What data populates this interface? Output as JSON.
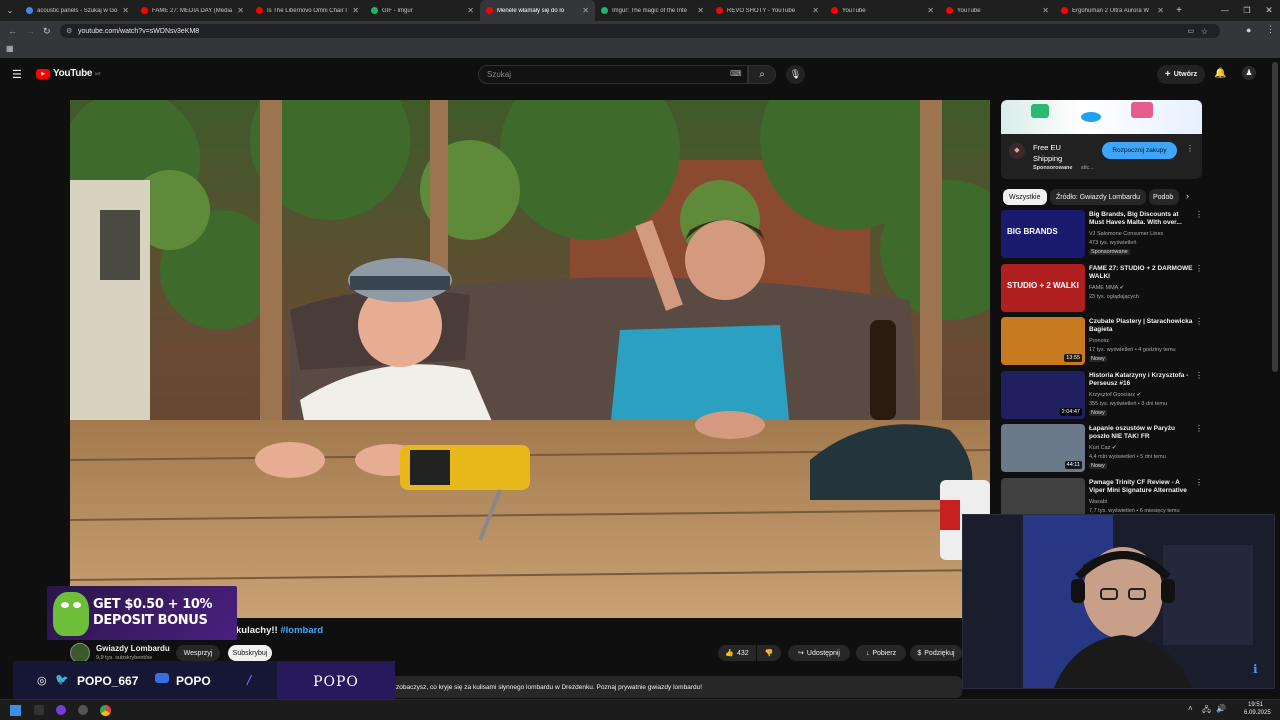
{
  "browser": {
    "tabs": [
      {
        "label": "acoustic panels - Szukaj w Go",
        "color": "#4285f4",
        "active": false
      },
      {
        "label": "FAME 27: MEDIA DAY (Media",
        "color": "#ff0000",
        "active": false
      },
      {
        "label": "Is The Libernovo Omni Chair I",
        "color": "#ff0000",
        "active": false
      },
      {
        "label": "GIF - Imgur",
        "color": "#1bb76e",
        "active": false
      },
      {
        "label": "Menele włamały się do lo",
        "color": "#ff0000",
        "active": true
      },
      {
        "label": "Imgur: The magic of the Inte",
        "color": "#1bb76e",
        "active": false
      },
      {
        "label": "REVO SHOTY - YouTube",
        "color": "#ff0000",
        "active": false
      },
      {
        "label": "YouTube",
        "color": "#ff0000",
        "active": false
      },
      {
        "label": "YouTube",
        "color": "#ff0000",
        "active": false
      },
      {
        "label": "Ergohuman 2 Ultra Aurora W",
        "color": "#ff0000",
        "active": false
      }
    ],
    "url": "youtube.com/watch?v=sWDNsv3eKM8"
  },
  "yt": {
    "logo_text": "YouTube",
    "logo_sup": "MT",
    "search_placeholder": "Szukaj",
    "create_label": "Utwórz"
  },
  "ad": {
    "title_line1": "Free EU",
    "title_line2": "Shipping",
    "sponsored": "Sponsorowane",
    "sponsored_tail": "stic...",
    "cta": "Rozpocznij zakupy"
  },
  "chips": [
    "Wszystkie",
    "Źródło: Gwiazdy Lombardu",
    "Podob"
  ],
  "videos": [
    {
      "title": "Big Brands, Big Discounts at Must Haves Malta. With over...",
      "channel": "VJ Salomone Consumer Lines",
      "meta": "473 tys. wyświetleń",
      "badge": "Sponsorowane",
      "duration": "",
      "thumb": "#1a1a6e",
      "thumb_text": "BIG BRANDS"
    },
    {
      "title": "FAME 27: STUDIO + 2 DARMOWE WALKI",
      "channel": "FAME MMA ✔",
      "meta": "23 tys. oglądających",
      "badge": "",
      "duration": "",
      "thumb": "#b02020",
      "thumb_text": "STUDIO + 2 WALKI"
    },
    {
      "title": "Czubate Plastery | Starachowicka Bagieta",
      "channel": "Pronosz",
      "meta": "17 tys. wyświetleń • 4 godziny temu",
      "badge": "Nowy",
      "duration": "13:55",
      "thumb": "#c87a20",
      "thumb_text": ""
    },
    {
      "title": "Historia Katarzyny i Krzysztofa - Perseusz #16",
      "channel": "Krzysztof Gonciarz ✔",
      "meta": "355 tys. wyświetleń • 3 dni temu",
      "badge": "Nowy",
      "duration": "2:04:47",
      "thumb": "#202060",
      "thumb_text": ""
    },
    {
      "title": "Łapanie oszustów w Paryżu poszło NIE TAK! FR",
      "channel": "Kurt Caz ✔",
      "meta": "4,4 mln wyświetleń • 5 dni temu",
      "badge": "Nowy",
      "duration": "44:11",
      "thumb": "#6a7a8a",
      "thumb_text": ""
    },
    {
      "title": "Pwnage Trinity CF Review - A Viper Mini Signature Alternative",
      "channel": "Wasabi",
      "meta": "7,7 tys. wyświetleń • 6 miesięcy temu",
      "badge": "",
      "duration": "",
      "thumb": "#404040",
      "thumb_text": ""
    }
  ],
  "video": {
    "title_tail": "kulachy!!",
    "hashtag": "#lombard",
    "channel": "Gwiazdy Lombardu",
    "subs": "9,9 tys. subskrybentów",
    "support": "Wesprzyj",
    "subscribe": "Subskrybuj",
    "likes": "432",
    "share": "Udostępnij",
    "download": "Pobierz",
    "thanks": "Podziękuj",
    "description": "zobaczysz, co kryje się za kulisami słynnego lombardu w Drezdenku. Poznaj prywatnie gwiazdy lombardu!"
  },
  "overlay": {
    "bonus_line1": "GET $0.50 + 10%",
    "bonus_line2": "DEPOSIT BONUS",
    "handle1": "POPO_667",
    "handle2": "POPO",
    "brand": "POPO"
  },
  "taskbar": {
    "time": "19:51",
    "date": "6.09.2025"
  }
}
